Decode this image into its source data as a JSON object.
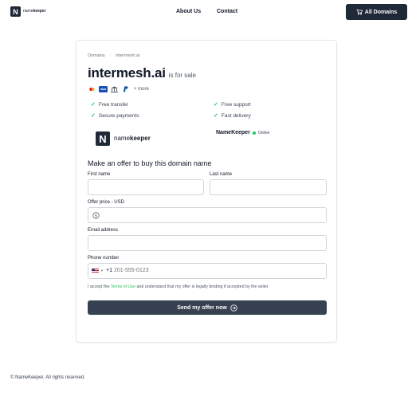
{
  "header": {
    "logo_letter": "N",
    "logo_name_prefix": "name",
    "logo_name_suffix": "keeper",
    "nav": {
      "about": "About Us",
      "contact": "Contact"
    },
    "all_domains": "All Domains"
  },
  "card": {
    "breadcrumb": {
      "root": "Domains",
      "current": "intermesh.ai"
    },
    "domain": "intermesh.ai",
    "for_sale": "is for sale",
    "payments": {
      "more": "+ more",
      "icons": [
        "mastercard-icon",
        "visa-icon",
        "bank-icon",
        "paypal-icon"
      ]
    },
    "features": [
      "Free transfer",
      "Free support",
      "Secure payments",
      "Fast delivery"
    ],
    "brand": {
      "letter": "N",
      "prefix": "name",
      "suffix": "keeper"
    },
    "seller": {
      "name": "NameKeeper",
      "status": "Online"
    },
    "form": {
      "title": "Make an offer to buy this domain name",
      "first_name": "First name",
      "last_name": "Last name",
      "offer_price": "Offer price - USD",
      "email": "Email address",
      "phone": "Phone number",
      "phone_code": "+1",
      "phone_placeholder": "201-555-0123",
      "terms_prefix": "I accept the",
      "terms_link": "Terms of Use",
      "terms_suffix": "and understand that my offer is legally binding if accepted by the seller",
      "submit": "Send my offer now"
    }
  },
  "footer": {
    "copyright": "© NameKeeper. All rights reserved."
  },
  "colors": {
    "dark": "#1f2937",
    "button": "#374151",
    "accent_green": "#22c55e"
  }
}
